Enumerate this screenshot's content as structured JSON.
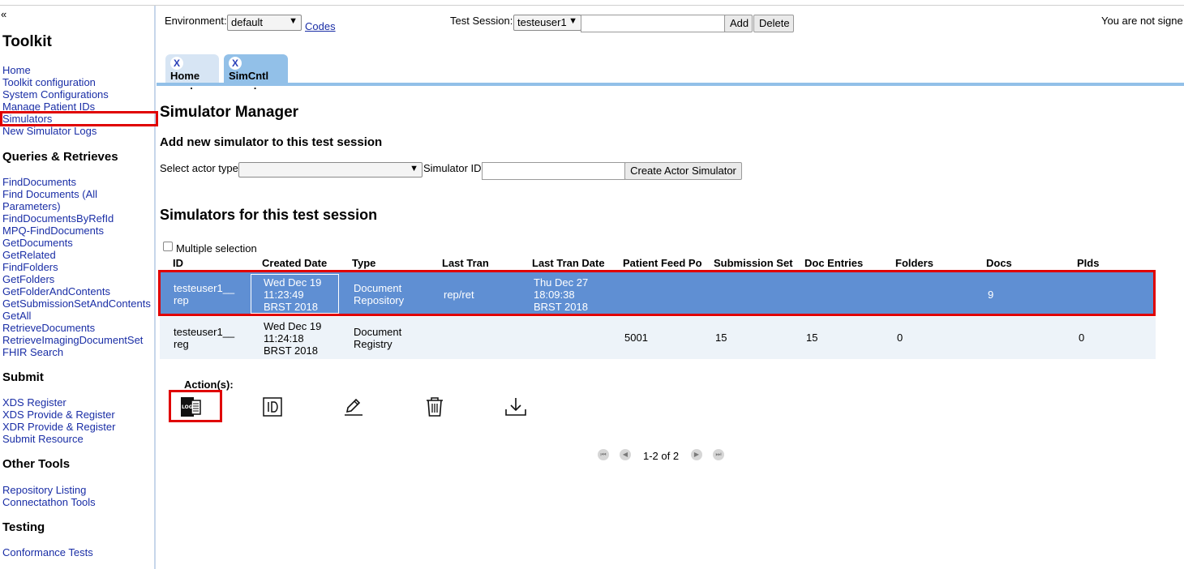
{
  "sidebar": {
    "collapse_glyph": "«",
    "title": "Toolkit",
    "sections": [
      {
        "heading": "",
        "links": [
          "Home",
          "Toolkit configuration",
          "System Configurations",
          "Manage Patient IDs",
          "Simulators",
          "New Simulator Logs"
        ]
      },
      {
        "heading": "Queries & Retrieves",
        "links": [
          "FindDocuments",
          "Find Documents (All",
          "Parameters)",
          "FindDocumentsByRefId",
          "MPQ-FindDocuments",
          "GetDocuments",
          "GetRelated",
          "FindFolders",
          "GetFolders",
          "GetFolderAndContents",
          "GetSubmissionSetAndContents",
          "GetAll",
          "RetrieveDocuments",
          "RetrieveImagingDocumentSet",
          "FHIR Search"
        ]
      },
      {
        "heading": "Submit",
        "links": [
          "XDS Register",
          "XDS Provide & Register",
          "XDR Provide & Register",
          "Submit Resource"
        ]
      },
      {
        "heading": "Other Tools",
        "links": [
          "Repository Listing",
          "Connectathon Tools"
        ]
      },
      {
        "heading": "Testing",
        "links": [
          "Conformance Tests"
        ]
      }
    ]
  },
  "topbar": {
    "environment_label": "Environment:",
    "environment_value": "default",
    "codes_link": "Codes",
    "test_session_label": "Test Session:",
    "test_session_value": "testeuser1",
    "add_button": "Add",
    "delete_button": "Delete",
    "signin_status": "You are not signe"
  },
  "tabs": [
    {
      "label": "Home",
      "close": "X",
      "sub": "."
    },
    {
      "label": "SimCntl",
      "close": "X",
      "sub": "."
    }
  ],
  "main": {
    "title": "Simulator Manager",
    "add_heading": "Add new simulator to this test session",
    "actor_type_label": "Select actor type",
    "actor_type_value": "",
    "simulator_id_label": "Simulator ID",
    "create_button": "Create Actor Simulator",
    "list_heading": "Simulators for this test session",
    "multiple_selection_label": "Multiple selection",
    "columns": [
      "ID",
      "Created Date",
      "Type",
      "Last Tran",
      "Last Tran Date",
      "Patient Feed Po",
      "Submission Set",
      "Doc Entries",
      "Folders",
      "Docs",
      "PIds"
    ],
    "rows": [
      {
        "id": [
          "testeuser1__",
          "rep"
        ],
        "created": [
          "Wed Dec 19",
          "11:23:49",
          "BRST 2018"
        ],
        "type": [
          "Document",
          "Repository"
        ],
        "last_tran": "rep/ret",
        "last_tran_date": [
          "Thu Dec 27",
          "18:09:38",
          "BRST 2018"
        ],
        "patient_feed": "",
        "submission_set": "",
        "doc_entries": "",
        "folders": "",
        "docs": "9",
        "pids": ""
      },
      {
        "id": [
          "testeuser1__",
          "reg"
        ],
        "created": [
          "Wed Dec 19",
          "11:24:18",
          "BRST 2018"
        ],
        "type": [
          "Document",
          "Registry"
        ],
        "last_tran": "",
        "last_tran_date": [
          "",
          "",
          ""
        ],
        "patient_feed": "5001",
        "submission_set": "15",
        "doc_entries": "15",
        "folders": "0",
        "docs": "",
        "pids": "0"
      }
    ],
    "actions_label": "Action(s):",
    "action_icons": [
      "log-icon",
      "id-icon",
      "edit-icon",
      "delete-icon",
      "download-icon"
    ],
    "pager_text": "1-2 of 2"
  },
  "colors": {
    "highlight": "#e00000",
    "selected_row": "#5f8fd3",
    "tab_active": "#92c0e8"
  }
}
